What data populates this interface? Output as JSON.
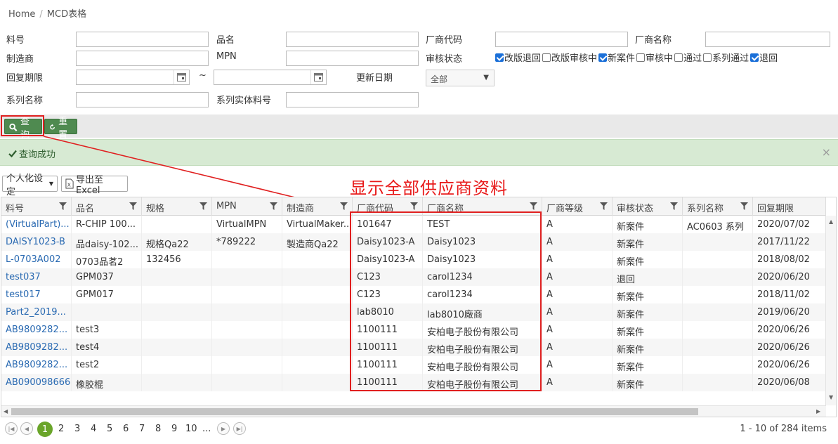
{
  "breadcrumb": {
    "home": "Home",
    "sep": "/",
    "current": "MCD表格"
  },
  "form": {
    "part_no": "料号",
    "product_name": "品名",
    "vendor_code": "厂商代码",
    "vendor_name": "厂商名称",
    "manufacturer": "制造商",
    "mpn": "MPN",
    "review_status": "审核状态",
    "reply_deadline": "回复期限",
    "tilde": "~",
    "update_date": "更新日期",
    "update_date_value": "全部",
    "series_name": "系列名称",
    "series_entity_part_no": "系列实体料号",
    "status_options": [
      {
        "label": "改版退回",
        "checked": true
      },
      {
        "label": "改版审核中",
        "checked": false
      },
      {
        "label": "新案件",
        "checked": true
      },
      {
        "label": "审核中",
        "checked": false
      },
      {
        "label": "通过",
        "checked": false
      },
      {
        "label": "系列通过",
        "checked": false
      },
      {
        "label": "退回",
        "checked": true
      }
    ]
  },
  "toolbar": {
    "query": "查询",
    "reset": "重置"
  },
  "alert": {
    "message": "查询成功",
    "close": "×"
  },
  "grid_tools": {
    "personalize": "个人化设定",
    "export": "导出至Excel"
  },
  "annotation": "显示全部供应商资料",
  "columns": [
    "料号",
    "品名",
    "规格",
    "MPN",
    "制造商",
    "厂商代码",
    "厂商名称",
    "厂商等级",
    "审核状态",
    "系列名称",
    "回复期限"
  ],
  "rows": [
    [
      "(VirtualPart)...",
      "R-CHIP 100...",
      "",
      "VirtualMPN",
      "VirtualMaker...",
      "101647",
      "TEST",
      "A",
      "新案件",
      "AC0603 系列",
      "2020/07/02"
    ],
    [
      "DAISY1023-B",
      "品daisy-102...",
      "规格Qa22",
      "*789222",
      "製造商Qa22",
      "Daisy1023-A",
      "Daisy1023",
      "A",
      "新案件",
      "",
      "2017/11/22"
    ],
    [
      "L-0703A002",
      "0703品茗2",
      "132456",
      "",
      "",
      "Daisy1023-A",
      "Daisy1023",
      "A",
      "新案件",
      "",
      "2018/08/02"
    ],
    [
      "test037",
      "GPM037",
      "",
      "",
      "",
      "C123",
      "carol1234",
      "A",
      "退回",
      "",
      "2020/06/20"
    ],
    [
      "test017",
      "GPM017",
      "",
      "",
      "",
      "C123",
      "carol1234",
      "A",
      "新案件",
      "",
      "2018/11/02"
    ],
    [
      "Part2_2019...",
      "",
      "",
      "",
      "",
      "lab8010",
      "lab8010廠商",
      "A",
      "新案件",
      "",
      "2019/06/20"
    ],
    [
      "AB9809282...",
      "test3",
      "",
      "",
      "",
      "1100111",
      "安柏电子股份有限公司",
      "A",
      "新案件",
      "",
      "2020/06/26"
    ],
    [
      "AB9809282...",
      "test4",
      "",
      "",
      "",
      "1100111",
      "安柏电子股份有限公司",
      "A",
      "新案件",
      "",
      "2020/06/26"
    ],
    [
      "AB9809282...",
      "test2",
      "",
      "",
      "",
      "1100111",
      "安柏电子股份有限公司",
      "A",
      "新案件",
      "",
      "2020/06/26"
    ],
    [
      "AB090098666",
      "橡胶棍",
      "",
      "",
      "",
      "1100111",
      "安柏电子股份有限公司",
      "A",
      "新案件",
      "",
      "2020/06/08"
    ]
  ],
  "pager": {
    "pages": [
      "1",
      "2",
      "3",
      "4",
      "5",
      "6",
      "7",
      "8",
      "9",
      "10",
      "..."
    ],
    "current": "1",
    "info": "1 - 10 of 284 items"
  }
}
